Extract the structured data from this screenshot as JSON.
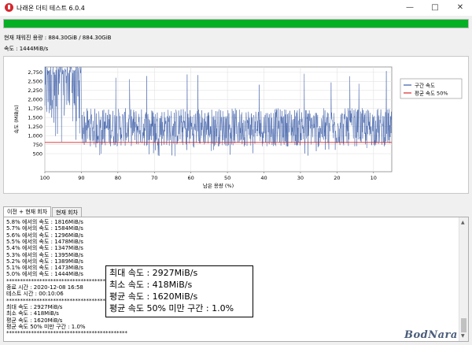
{
  "window": {
    "title": "나래온 더티 테스트 6.0.4",
    "minimize": "—",
    "maximize": "□",
    "close": "✕"
  },
  "progress": {
    "fraction": 1.0,
    "color": "#06b025"
  },
  "status": {
    "used_label": "현재 채워진 용량 : 884.30GiB / 884.30GiB",
    "speed_label": "속도 : 1444MiB/s"
  },
  "chart_data": {
    "type": "line",
    "xlabel": "남은 용량 (%)",
    "ylabel": "속도 (MiB/s)",
    "xlim": [
      100,
      5
    ],
    "ylim": [
      0,
      2900
    ],
    "x_ticks": [
      100,
      90,
      80,
      70,
      60,
      50,
      40,
      30,
      20,
      10
    ],
    "y_ticks": [
      500,
      750,
      1000,
      1250,
      1500,
      1750,
      2000,
      2250,
      2500,
      2750
    ],
    "legend_position": "right",
    "grid": true,
    "series": [
      {
        "name": "구간 속도",
        "color": "#3a5ba6",
        "segments": [
          {
            "x_range": [
              100,
              90
            ],
            "low": 1350,
            "high": 2927,
            "peak_low": 2700,
            "min_dip": 600
          },
          {
            "x_range": [
              90,
              5
            ],
            "low": 700,
            "high": 1760,
            "min_dip": 418,
            "max_spike": 2927
          }
        ],
        "avg": 1620
      },
      {
        "name": "평균 속도 50%",
        "color": "#d62728",
        "points": [
          [
            100,
            810
          ],
          [
            5,
            810
          ]
        ]
      }
    ]
  },
  "tabs": [
    "이전 + 현재 회차",
    "현재 회차"
  ],
  "log": [
    "5.8% 에서의 속도 : 1816MiB/s",
    "5.7% 에서의 속도 : 1584MiB/s",
    "5.6% 에서의 속도 : 1296MiB/s",
    "5.5% 에서의 속도 : 1478MiB/s",
    "5.4% 에서의 속도 : 1347MiB/s",
    "5.3% 에서의 속도 : 1395MiB/s",
    "5.2% 에서의 속도 : 1389MiB/s",
    "5.1% 에서의 속도 : 1473MiB/s",
    "5.0% 에서의 속도 : 1444MiB/s",
    "********************************************",
    "종료 시간 : 2020-12-08 16:58",
    "테스트 시간 : 00:10:06",
    "********************************************",
    "최대 속도 : 2927MiB/s",
    "최소 속도 : 418MiB/s",
    "평균 속도 : 1620MiB/s",
    "평균 속도 50% 미만 구간 : 1.0%",
    "********************************************"
  ],
  "summary": {
    "max": "최대 속도 : 2927MiB/s",
    "min": "최소 속도 : 418MiB/s",
    "avg": "평균 속도 : 1620MiB/s",
    "below": "평균 속도 50% 미만 구간 : 1.0%"
  },
  "watermark": "BodNara"
}
